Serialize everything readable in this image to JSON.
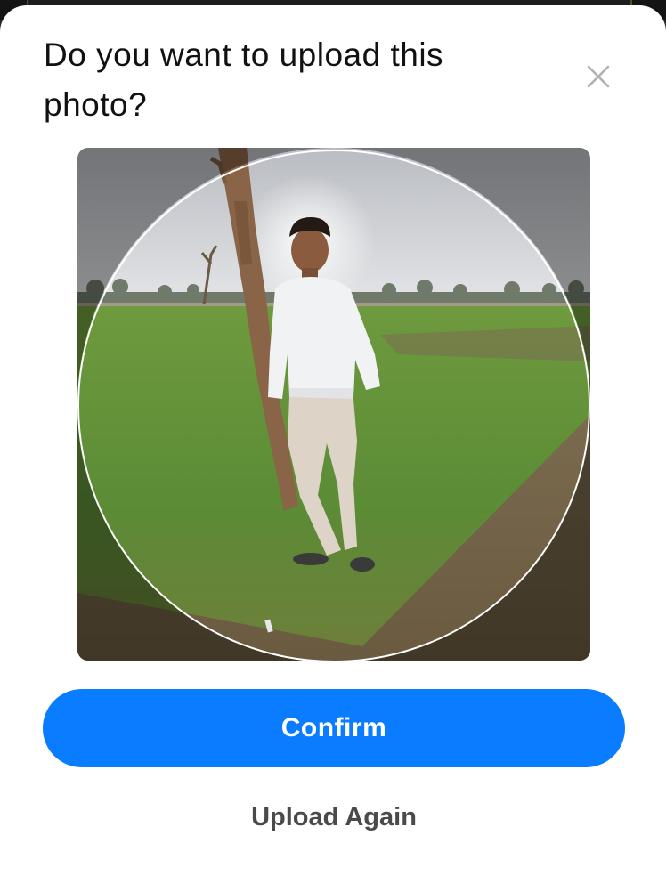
{
  "dialog": {
    "title": "Do you want to upload this photo?",
    "close_icon": "close-icon",
    "confirm_label": "Confirm",
    "upload_again_label": "Upload Again"
  },
  "colors": {
    "accent": "#0a7cff",
    "secondary_text": "#4a4a4a",
    "title_text": "#111111",
    "close_icon": "#b0b0b0"
  }
}
